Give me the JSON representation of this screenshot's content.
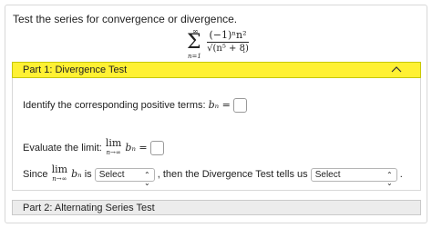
{
  "question": "Test the series for convergence or divergence.",
  "series": {
    "sigma_upper": "∞",
    "sigma_lower": "n=1",
    "numerator": "(−1)ⁿn²",
    "denominator": "√(n⁵ + 8)",
    "trailing": "."
  },
  "part1": {
    "title": "Part 1: Divergence Test",
    "identify_label": "Identify the corresponding positive terms:",
    "bn_symbol": "bₙ =",
    "evaluate_label": "Evaluate the limit:",
    "lim_word": "lim",
    "lim_sub": "n→∞",
    "since_prefix": "Since",
    "since_is": "is",
    "select1_value": "Select",
    "then_text": ", then the Divergence Test tells us",
    "select2_value": "Select",
    "end_punct": "."
  },
  "part2": {
    "title": "Part 2: Alternating Series Test"
  },
  "colors": {
    "part1_bg": "#fff133",
    "part2_bg": "#ececec"
  }
}
